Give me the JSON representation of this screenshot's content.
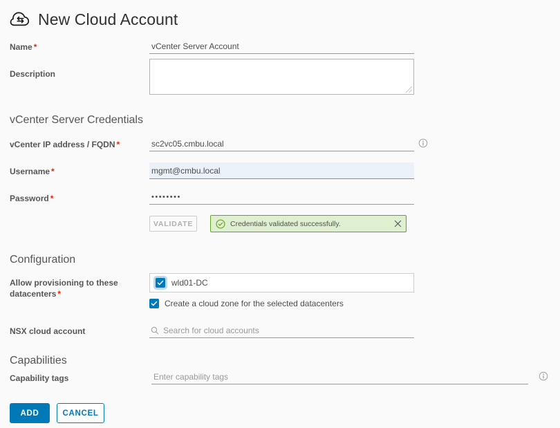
{
  "header": {
    "title": "New Cloud Account",
    "icon": "cloud-sync-icon"
  },
  "form": {
    "name": {
      "label": "Name",
      "required": "*",
      "value": "vCenter Server Account"
    },
    "description": {
      "label": "Description",
      "value": ""
    }
  },
  "credentials_section": {
    "title": "vCenter Server Credentials",
    "vcenter_host": {
      "label": "vCenter IP address / FQDN",
      "required": "*",
      "value": "sc2vc05.cmbu.local",
      "info_icon": "info-icon"
    },
    "username": {
      "label": "Username",
      "required": "*",
      "value": "mgmt@cmbu.local"
    },
    "password": {
      "label": "Password",
      "required": "*",
      "value": "••••••••"
    },
    "validate_button": {
      "label": "VALIDATE",
      "disabled": true
    },
    "alert": {
      "message": "Credentials validated successfully.",
      "status_icon": "check-circle-icon",
      "close_icon": "close-icon",
      "border_color": "#62a420",
      "background_color": "#dff0d0"
    }
  },
  "configuration_section": {
    "title": "Configuration",
    "datacenters": {
      "label": "Allow provisioning to these datacenters",
      "required": "*",
      "selected": [
        {
          "name": "wld01-DC",
          "checked": true
        }
      ]
    },
    "create_cloud_zone": {
      "label": "Create a cloud zone for the selected datacenters",
      "checked": true
    },
    "nsx_cloud_account": {
      "label": "NSX cloud account",
      "placeholder": "Search for cloud accounts",
      "value": "",
      "search_icon": "search-icon"
    }
  },
  "capabilities_section": {
    "title": "Capabilities",
    "capability_tags": {
      "label": "Capability tags",
      "placeholder": "Enter capability tags",
      "value": "",
      "info_icon": "info-icon"
    }
  },
  "footer": {
    "add_button": "ADD",
    "cancel_button": "CANCEL"
  },
  "colors": {
    "accent": "#0079b8",
    "required_marker": "#e62700",
    "success_border": "#62a420",
    "success_bg": "#dff0d0",
    "page_bg": "#fafafa"
  }
}
